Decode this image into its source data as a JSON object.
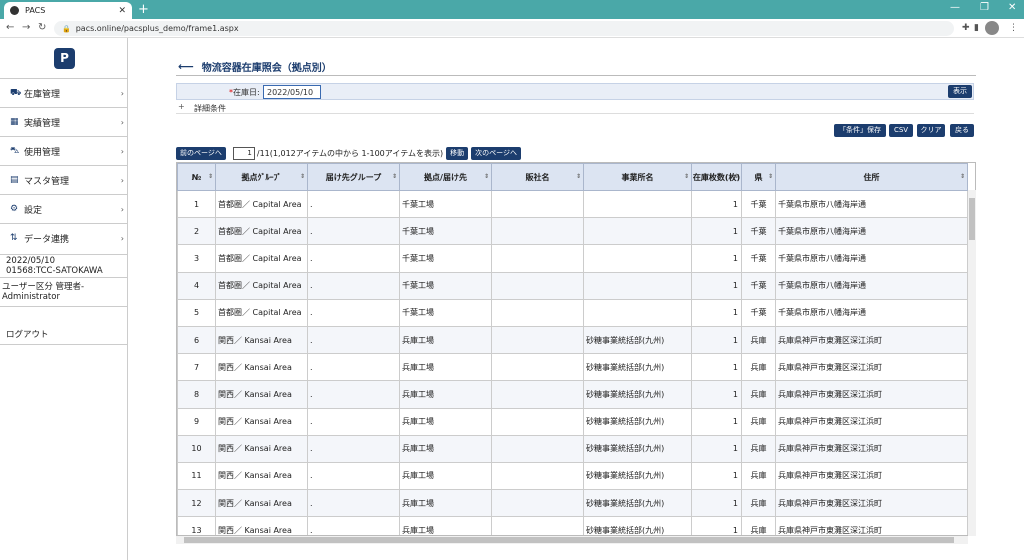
{
  "browser": {
    "tab_title": "PACS",
    "tab_close": "✕",
    "new_tab": "+",
    "url": "pacs.online/pacsplus_demo/frame1.aspx",
    "minimize": "—",
    "restore": "❐",
    "close": "✕"
  },
  "sidebar": {
    "logo": "P",
    "items": [
      {
        "label": "在庫管理",
        "icon": "truck-icon"
      },
      {
        "label": "実績管理",
        "icon": "table-icon"
      },
      {
        "label": "使用管理",
        "icon": "cart-icon"
      },
      {
        "label": "マスタ管理",
        "icon": "file-icon"
      },
      {
        "label": "設定",
        "icon": "gear-icon"
      },
      {
        "label": "データ連携",
        "icon": "transfer-icon"
      }
    ],
    "date": "2022/05/10",
    "user_id": "01568:TCC-SATOKAWA",
    "user_role": "ユーザー区分 管理者-Administrator",
    "logout": "ログアウト"
  },
  "page": {
    "title": "物流容器在庫照会（拠点別）",
    "filter_label": "在庫日:",
    "filter_value": "2022/05/10",
    "display_button": "表示",
    "detail_toggle": "+",
    "detail_label": "詳細条件",
    "save_condition_button": "「条件」保存",
    "csv_button": "CSV",
    "clear_button": "クリア",
    "back_button": "戻る"
  },
  "pager": {
    "prev": "前のページへ",
    "current": "1",
    "info": "/11(1,012アイテムの中から 1-100アイテムを表示)",
    "move": "移動",
    "next": "次のページへ"
  },
  "table": {
    "headers": [
      "№",
      "拠点ｸﾞﾙｰﾌﾟ",
      "届け先グループ",
      "拠点/届け先",
      "販社名",
      "事業所名",
      "在庫枚数(枚)",
      "県",
      "住所"
    ],
    "rows": [
      [
        "1",
        "首都圏／ Capital Area",
        ".",
        "千葉工場",
        "",
        "",
        "1",
        "千葉",
        "千葉県市原市八幡海岸通"
      ],
      [
        "2",
        "首都圏／ Capital Area",
        ".",
        "千葉工場",
        "",
        "",
        "1",
        "千葉",
        "千葉県市原市八幡海岸通"
      ],
      [
        "3",
        "首都圏／ Capital Area",
        ".",
        "千葉工場",
        "",
        "",
        "1",
        "千葉",
        "千葉県市原市八幡海岸通"
      ],
      [
        "4",
        "首都圏／ Capital Area",
        ".",
        "千葉工場",
        "",
        "",
        "1",
        "千葉",
        "千葉県市原市八幡海岸通"
      ],
      [
        "5",
        "首都圏／ Capital Area",
        ".",
        "千葉工場",
        "",
        "",
        "1",
        "千葉",
        "千葉県市原市八幡海岸通"
      ],
      [
        "6",
        "関西／ Kansai Area",
        ".",
        "兵庫工場",
        "",
        "砂糖事業統括部(九州)",
        "1",
        "兵庫",
        "兵庫県神戸市東灘区深江浜町"
      ],
      [
        "7",
        "関西／ Kansai Area",
        ".",
        "兵庫工場",
        "",
        "砂糖事業統括部(九州)",
        "1",
        "兵庫",
        "兵庫県神戸市東灘区深江浜町"
      ],
      [
        "8",
        "関西／ Kansai Area",
        ".",
        "兵庫工場",
        "",
        "砂糖事業統括部(九州)",
        "1",
        "兵庫",
        "兵庫県神戸市東灘区深江浜町"
      ],
      [
        "9",
        "関西／ Kansai Area",
        ".",
        "兵庫工場",
        "",
        "砂糖事業統括部(九州)",
        "1",
        "兵庫",
        "兵庫県神戸市東灘区深江浜町"
      ],
      [
        "10",
        "関西／ Kansai Area",
        ".",
        "兵庫工場",
        "",
        "砂糖事業統括部(九州)",
        "1",
        "兵庫",
        "兵庫県神戸市東灘区深江浜町"
      ],
      [
        "11",
        "関西／ Kansai Area",
        ".",
        "兵庫工場",
        "",
        "砂糖事業統括部(九州)",
        "1",
        "兵庫",
        "兵庫県神戸市東灘区深江浜町"
      ],
      [
        "12",
        "関西／ Kansai Area",
        ".",
        "兵庫工場",
        "",
        "砂糖事業統括部(九州)",
        "1",
        "兵庫",
        "兵庫県神戸市東灘区深江浜町"
      ],
      [
        "13",
        "関西／ Kansai Area",
        ".",
        "兵庫工場",
        "",
        "砂糖事業統括部(九州)",
        "1",
        "兵庫",
        "兵庫県神戸市東灘区深江浜町"
      ]
    ]
  },
  "colors": {
    "accent": "#1c3d6e",
    "tabbar": "#4aa8a8",
    "header_bg": "#dce4f2"
  }
}
